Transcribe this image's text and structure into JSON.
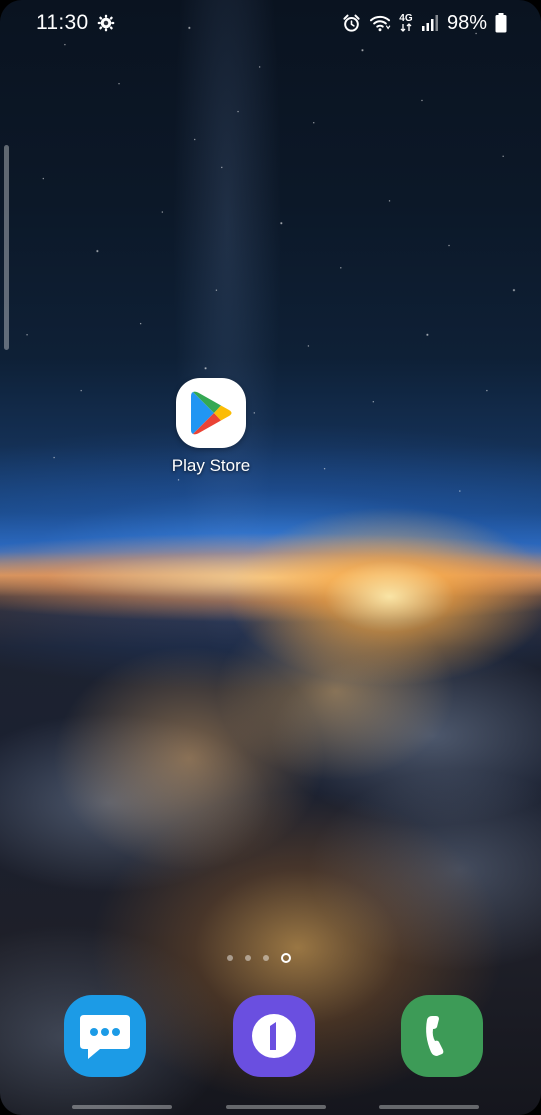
{
  "status_bar": {
    "time": "11:30",
    "network_type": "4G",
    "battery_percent": "98%",
    "icons": [
      "settings-gear-icon",
      "alarm-icon",
      "wifi-icon",
      "mobile-data-icon",
      "signal-icon",
      "battery-icon"
    ]
  },
  "home": {
    "apps": [
      {
        "label": "Play Store",
        "icon": "play-store-icon"
      }
    ],
    "pages": 4,
    "active_page": 4
  },
  "dock": {
    "apps": [
      {
        "icon": "messages-icon",
        "color": "#1c9be6"
      },
      {
        "icon": "samsung-one-icon",
        "color": "#6a4fe0"
      },
      {
        "icon": "phone-icon",
        "color": "#3d9b57"
      }
    ]
  }
}
